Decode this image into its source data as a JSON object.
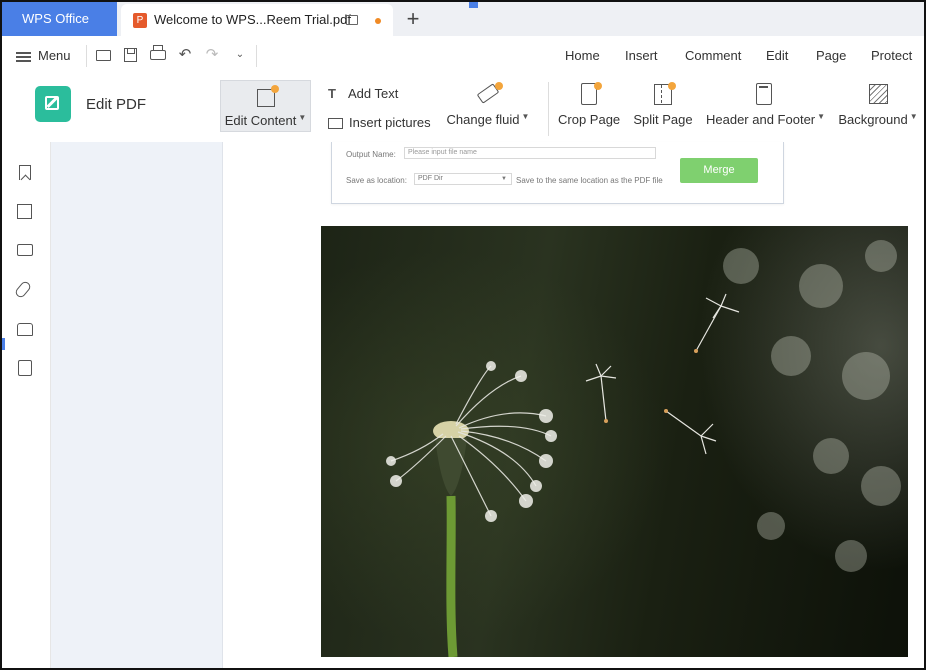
{
  "app": {
    "home_tab": "WPS Office",
    "doc_tab_title": "Welcome to WPS...Reem Trial.pdf",
    "new_tab_symbol": "+"
  },
  "menubar": {
    "menu_label": "Menu",
    "quick_access": [
      "open-folder-icon",
      "save-icon",
      "print-icon",
      "undo-icon",
      "redo-icon",
      "customize-icon"
    ],
    "tabs": [
      "Home",
      "Insert",
      "Comment",
      "Edit",
      "Page",
      "Protect"
    ]
  },
  "ribbon": {
    "edit_pdf_label": "Edit PDF",
    "edit_content": "Edit Content",
    "add_text": "Add Text",
    "insert_pictures": "Insert pictures",
    "change_fluid": "Change fluid",
    "crop_page": "Crop Page",
    "split_page": "Split Page",
    "header_footer": "Header and Footer",
    "background": "Background"
  },
  "sidebar": {
    "icons": [
      "bookmark-icon",
      "thumbnail-icon",
      "comment-icon",
      "attachment-icon",
      "signature-icon",
      "extract-icon"
    ]
  },
  "document": {
    "dialog": {
      "output_name_label": "Output Name:",
      "output_name_placeholder": "Please input file name",
      "save_location_label": "Save as location:",
      "save_location_value": "PDF Dir",
      "save_location_hint": "Save to the same location as the PDF file",
      "merge_button": "Merge"
    },
    "image_subject": "dandelion seed head"
  },
  "colors": {
    "accent": "#4a7fe6",
    "edit_pdf_green": "#2bbd9c",
    "merge_green": "#7fd06f",
    "badge_orange": "#f3a53c"
  }
}
